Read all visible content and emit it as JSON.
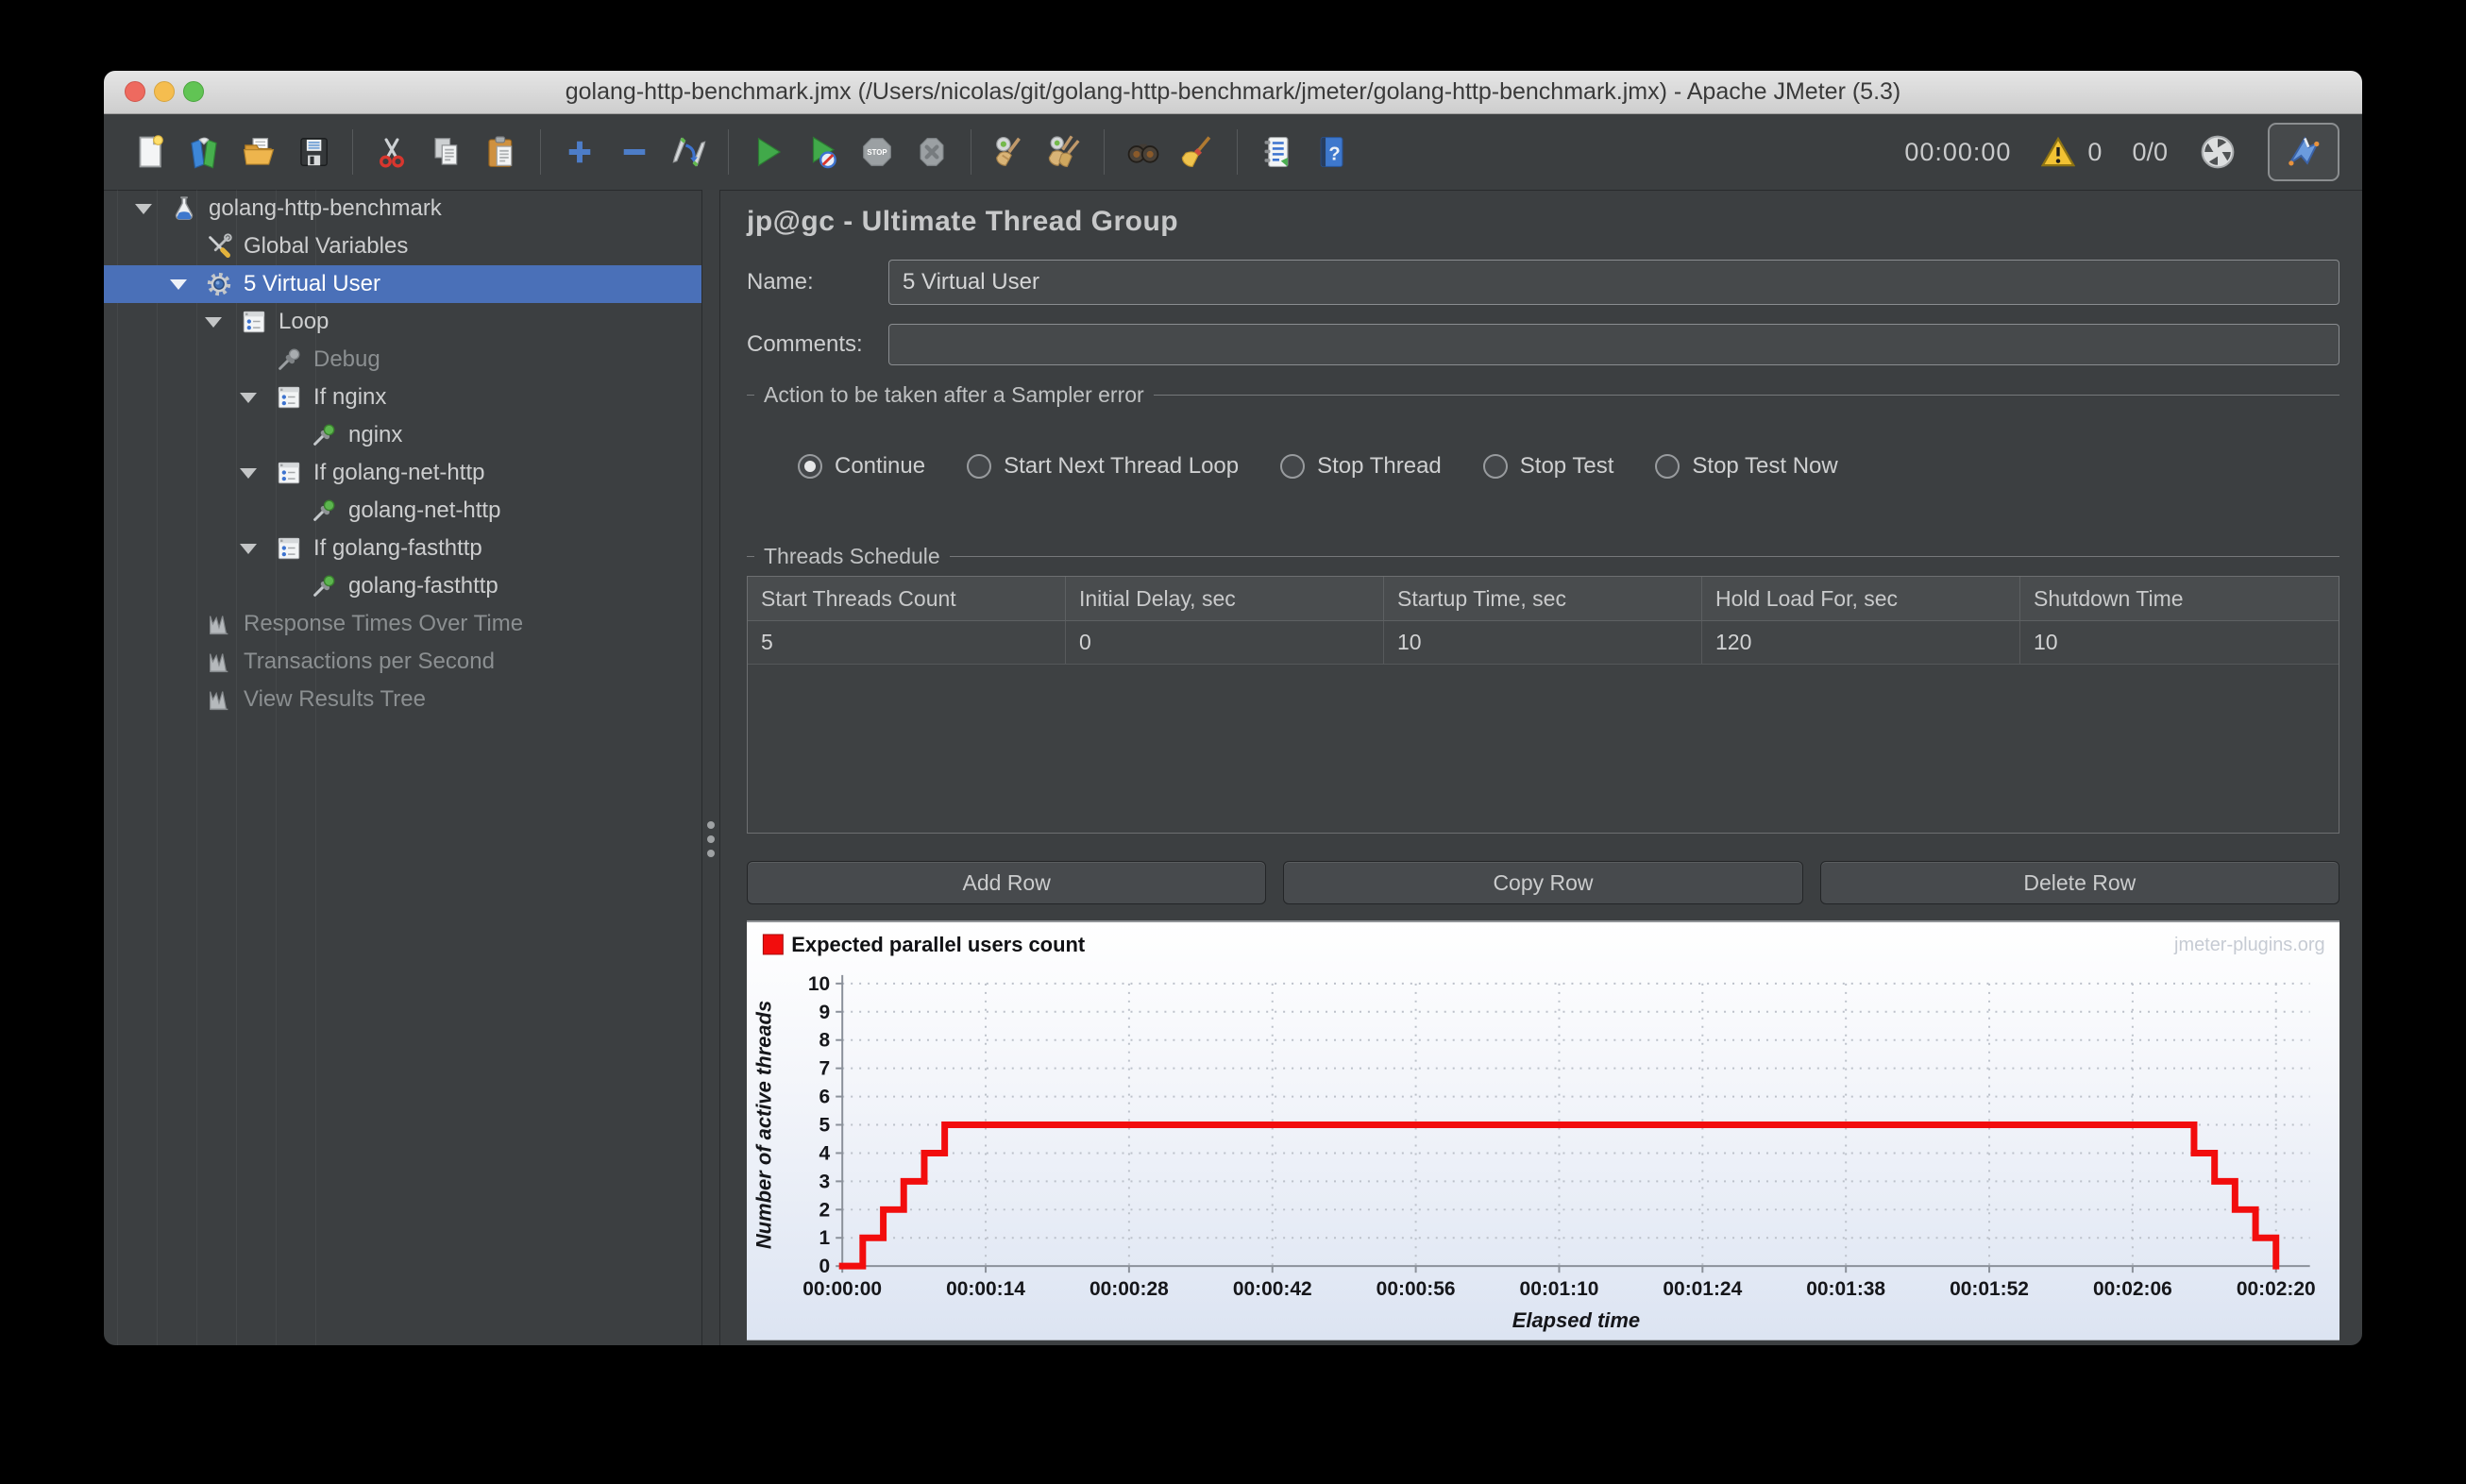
{
  "window": {
    "title": "golang-http-benchmark.jmx (/Users/nicolas/git/golang-http-benchmark/jmeter/golang-http-benchmark.jmx) - Apache JMeter (5.3)"
  },
  "toolbar": {
    "items": [
      {
        "icon": "new-file"
      },
      {
        "icon": "templates"
      },
      {
        "icon": "open-file"
      },
      {
        "icon": "save"
      },
      {
        "sep": true
      },
      {
        "icon": "cut"
      },
      {
        "icon": "copy"
      },
      {
        "icon": "paste"
      },
      {
        "sep": true
      },
      {
        "icon": "add"
      },
      {
        "icon": "remove"
      },
      {
        "icon": "toggle"
      },
      {
        "sep": true
      },
      {
        "icon": "start"
      },
      {
        "icon": "start-no-timers"
      },
      {
        "icon": "stop",
        "disabled": true
      },
      {
        "icon": "shutdown",
        "disabled": true
      },
      {
        "sep": true
      },
      {
        "icon": "clear"
      },
      {
        "icon": "clear-all"
      },
      {
        "sep": true
      },
      {
        "icon": "search"
      },
      {
        "icon": "search-reset"
      },
      {
        "sep": true
      },
      {
        "icon": "function-helper"
      },
      {
        "icon": "help"
      }
    ],
    "stop_label": "STOP",
    "timer": "00:00:00",
    "warning_count": "0",
    "thread_status": "0/0"
  },
  "tree": {
    "items": [
      {
        "label": "golang-http-benchmark",
        "icon": "test-plan",
        "level": 0,
        "expander": true
      },
      {
        "label": "Global Variables",
        "icon": "variables",
        "level": 1
      },
      {
        "label": "5 Virtual User",
        "icon": "thread-group",
        "level": 1,
        "expander": true,
        "selected": true
      },
      {
        "label": "Loop",
        "icon": "controller",
        "level": 2,
        "expander": true
      },
      {
        "label": "Debug",
        "icon": "sampler-disabled",
        "level": 3,
        "disabled": true
      },
      {
        "label": "If nginx",
        "icon": "controller",
        "level": 3,
        "expander": true
      },
      {
        "label": "nginx",
        "icon": "sampler",
        "level": 4
      },
      {
        "label": "If golang-net-http",
        "icon": "controller",
        "level": 3,
        "expander": true
      },
      {
        "label": "golang-net-http",
        "icon": "sampler",
        "level": 4
      },
      {
        "label": "If golang-fasthttp",
        "icon": "controller",
        "level": 3,
        "expander": true
      },
      {
        "label": "golang-fasthttp",
        "icon": "sampler",
        "level": 4
      },
      {
        "label": "Response Times Over Time",
        "icon": "listener",
        "level": 1,
        "disabled": true
      },
      {
        "label": "Transactions per Second",
        "icon": "listener",
        "level": 1,
        "disabled": true
      },
      {
        "label": "View Results Tree",
        "icon": "listener",
        "level": 1,
        "disabled": true
      }
    ]
  },
  "main": {
    "title": "jp@gc - Ultimate Thread Group",
    "name_label": "Name:",
    "name_value": "5 Virtual User",
    "comments_label": "Comments:",
    "comments_value": "",
    "sampler_error": {
      "legend": "Action to be taken after a Sampler error",
      "options": [
        {
          "label": "Continue",
          "selected": true
        },
        {
          "label": "Start Next Thread Loop"
        },
        {
          "label": "Stop Thread"
        },
        {
          "label": "Stop Test"
        },
        {
          "label": "Stop Test Now"
        }
      ]
    },
    "threads_schedule": {
      "legend": "Threads Schedule",
      "columns": [
        "Start Threads Count",
        "Initial Delay, sec",
        "Startup Time, sec",
        "Hold Load For, sec",
        "Shutdown Time"
      ],
      "rows": [
        [
          "5",
          "0",
          "10",
          "120",
          "10"
        ]
      ]
    },
    "buttons": [
      "Add Row",
      "Copy Row",
      "Delete Row"
    ]
  },
  "chart_data": {
    "type": "line",
    "step": true,
    "series": [
      {
        "name": "Expected parallel users count",
        "color": "#f20d0d",
        "points": [
          [
            0,
            0
          ],
          [
            2,
            0
          ],
          [
            2,
            1
          ],
          [
            4,
            1
          ],
          [
            4,
            2
          ],
          [
            6,
            2
          ],
          [
            6,
            3
          ],
          [
            8,
            3
          ],
          [
            8,
            4
          ],
          [
            10,
            4
          ],
          [
            10,
            5
          ],
          [
            132,
            5
          ],
          [
            132,
            4
          ],
          [
            134,
            4
          ],
          [
            134,
            3
          ],
          [
            136,
            3
          ],
          [
            136,
            2
          ],
          [
            138,
            2
          ],
          [
            138,
            1
          ],
          [
            140,
            1
          ],
          [
            140,
            0
          ]
        ]
      }
    ],
    "xlabel": "Elapsed time",
    "ylabel": "Number of active threads",
    "xlim": [
      0,
      140
    ],
    "ylim": [
      0,
      10
    ],
    "x_ticks": [
      0,
      14,
      28,
      42,
      56,
      70,
      84,
      98,
      112,
      126,
      140
    ],
    "x_tick_labels": [
      "00:00:00",
      "00:00:14",
      "00:00:28",
      "00:00:42",
      "00:00:56",
      "00:01:10",
      "00:01:24",
      "00:01:38",
      "00:01:52",
      "00:02:06",
      "00:02:20"
    ],
    "y_ticks": [
      0,
      1,
      2,
      3,
      4,
      5,
      6,
      7,
      8,
      9,
      10
    ],
    "grid": "dashed",
    "legend_position": "top-left",
    "watermark": "jmeter-plugins.org"
  }
}
